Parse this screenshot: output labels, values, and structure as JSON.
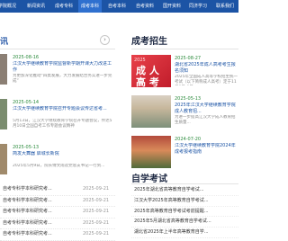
{
  "nav": {
    "items": [
      "学院概况",
      "新闻资讯",
      "成考专科",
      "成考本科",
      "自考本科",
      "自考资料",
      "国开资料",
      "同济学习",
      "联系我们"
    ]
  },
  "left": {
    "title_fragment": "讯",
    "news": [
      {
        "date": "2025-08-16",
        "title": "江汉大学继续教育学院监督新学期开课大力改进工作",
        "desc": "为更加深化推动“四类发展，大力发展结合务实进一步完成”"
      },
      {
        "date": "2025-05-14",
        "title": "江汉大学继续教育学院召开专题会议传达省考...",
        "desc": "5月13日，江汉大学继续教育学院召开专题会议，传达5月10日全国自考工作专题会议精神"
      },
      {
        "date": "2025-05-13",
        "title": "简发大舞器 启城长新院",
        "desc": "2025年5月9日，院长傅文雨及党总支书记一行到..."
      }
    ],
    "list": [
      {
        "title": "自考专科学本科研究考...",
        "date": "2025-09-21"
      },
      {
        "title": "自考专科学本科研究考...",
        "date": "2025-09-21"
      },
      {
        "title": "自考专科学本科研究考...",
        "date": "2025-09-21"
      },
      {
        "title": "自考专科学本科研究考...",
        "date": "2025-09-21"
      },
      {
        "title": "自考专科学本科研究考...",
        "date": "2025-09-21"
      }
    ]
  },
  "right": {
    "title": "成考招生",
    "news": [
      {
        "date": "2025-08-27",
        "title": "湖北省2025年成人高考考生报名须知",
        "desc": "2025年全国成人高等学校招生统一考试（以下简称成人高考）定于11月8日-9日...",
        "img_big": "成 人",
        "img_big2": "高 考",
        "img_year": "2025"
      },
      {
        "date": "2025-05-13",
        "title": "2025年江汉大学继续教育学院成人教育招...",
        "desc": "为进一步提高江汉大学成人教育招生质量..."
      },
      {
        "date": "2024-07-20",
        "title": "江汉大学继续教育学院2024年成考报考指南",
        "desc": ""
      }
    ],
    "title2": "自学考试",
    "list2": [
      "2025年湖北省高等教育自学考试...",
      "江汉大学2025年高等教育自学考试...",
      "2025年高等教育自学考试考前提醒...",
      "2025年5月湖北省高等教育自学考试...",
      "湖北省2025年上半年高等教育自学..."
    ]
  },
  "colors": {
    "nav_bg": "#1c54a5",
    "link": "#1c54a5",
    "date": "#2a8a3b"
  }
}
